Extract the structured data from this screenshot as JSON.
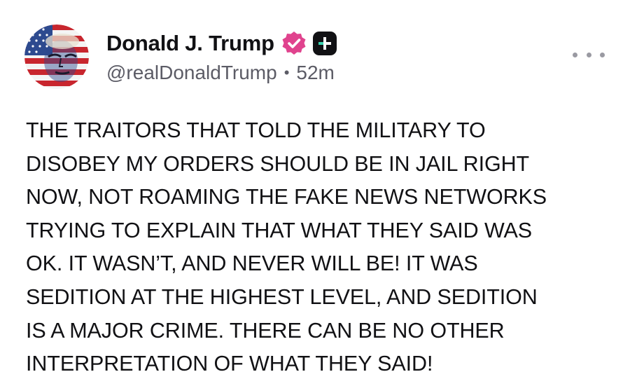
{
  "author": {
    "display_name": "Donald J. Trump",
    "handle": "@realDonaldTrump",
    "separator": "•",
    "timestamp": "52m",
    "avatar_icon": "american-flag-portrait-avatar",
    "verified_icon": "verified-badge-icon",
    "verified_color": "#e0438e",
    "plus_icon": "plus-badge-icon",
    "plus_color": "#111114",
    "plus_accent": "#3ad3b0"
  },
  "menu": {
    "icon": "more-options-icon"
  },
  "post": {
    "lines": [
      "THE TRAITORS THAT TOLD THE MILITARY TO",
      "DISOBEY MY ORDERS SHOULD BE IN JAIL RIGHT",
      "NOW, NOT ROAMING THE FAKE NEWS NETWORKS",
      "TRYING TO EXPLAIN THAT WHAT THEY SAID WAS",
      "OK. IT WASN’T, AND NEVER WILL BE! IT WAS",
      "SEDITION AT THE HIGHEST LEVEL, AND SEDITION",
      "IS A MAJOR CRIME. THERE CAN BE NO OTHER",
      "INTERPRETATION OF WHAT THEY SAID!"
    ]
  }
}
